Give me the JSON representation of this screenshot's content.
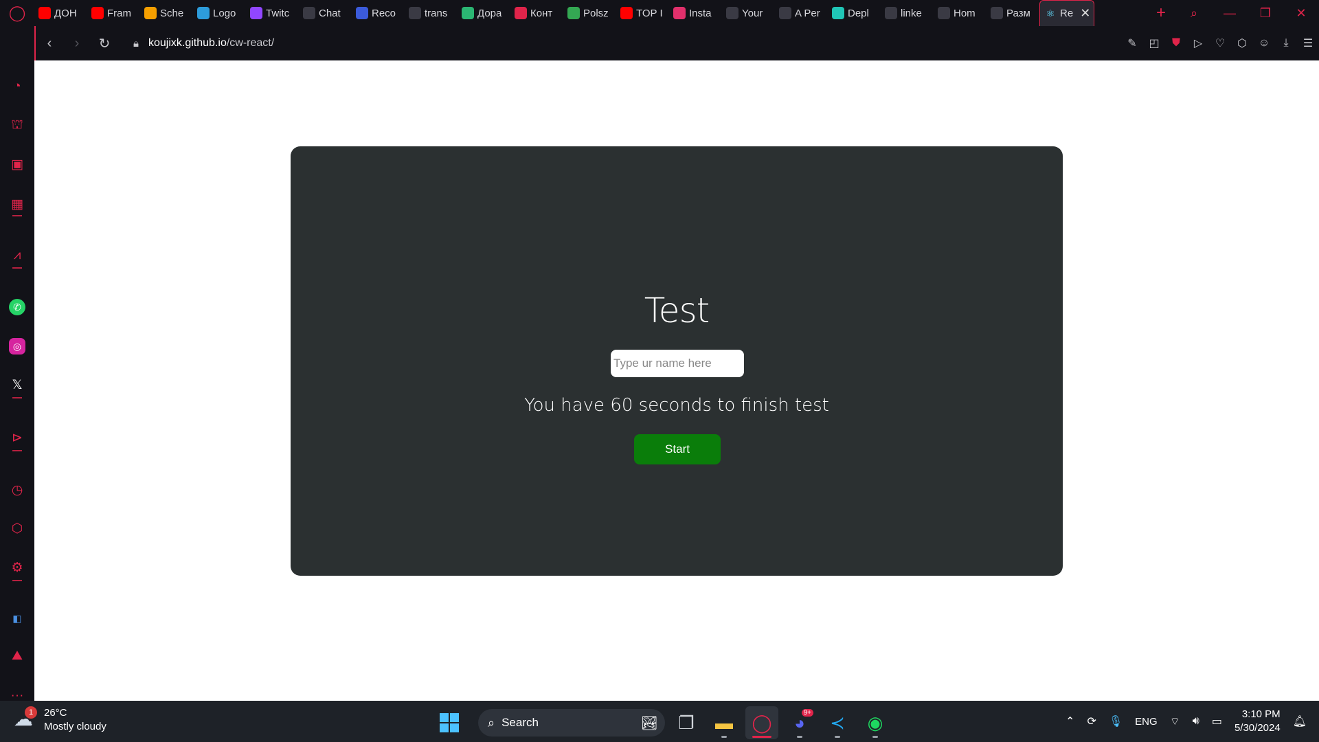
{
  "browser": {
    "tabs": [
      {
        "label": "ДОН",
        "icon": "youtube-icon",
        "color": "#ff0000"
      },
      {
        "label": "Fram",
        "icon": "youtube-icon",
        "color": "#ff0000"
      },
      {
        "label": "Sche",
        "icon": "u-icon",
        "color": "#f59f00"
      },
      {
        "label": "Logo",
        "icon": "logo-icon",
        "color": "#2d9cdb"
      },
      {
        "label": "Twitc",
        "icon": "twitch-icon",
        "color": "#9146ff"
      },
      {
        "label": "Chat",
        "icon": "openai-icon",
        "color": "#ffffff"
      },
      {
        "label": "Reco",
        "icon": "reco-icon",
        "color": "#3b5bdb"
      },
      {
        "label": "trans",
        "icon": "google-icon",
        "color": "#ffffff"
      },
      {
        "label": "Дора",
        "icon": "map-icon",
        "color": "#2bb673"
      },
      {
        "label": "Конт",
        "icon": "pin-icon",
        "color": "#e0244a"
      },
      {
        "label": "Polsz",
        "icon": "maps-icon",
        "color": "#34a853"
      },
      {
        "label": "TOP I",
        "icon": "youtube-icon",
        "color": "#ff0000"
      },
      {
        "label": "Insta",
        "icon": "instagram-icon",
        "color": "#e1306c"
      },
      {
        "label": "Your",
        "icon": "github-icon",
        "color": "#ffffff"
      },
      {
        "label": "A Per",
        "icon": "codepen-icon",
        "color": "#ffffff"
      },
      {
        "label": "Depl",
        "icon": "netlify-icon",
        "color": "#20c6b7"
      },
      {
        "label": "linke",
        "icon": "google-icon",
        "color": "#ffffff"
      },
      {
        "label": "Hom",
        "icon": "globe-icon",
        "color": "#ffffff"
      },
      {
        "label": "Разм",
        "icon": "x-icon",
        "color": "#ffffff"
      }
    ],
    "active_tab": {
      "label": "Re",
      "icon": "react-icon"
    },
    "url_host": "koujixk.github.io",
    "url_path": "/cw-react/"
  },
  "app": {
    "title": "Test",
    "name_placeholder": "Type ur name here",
    "info": "You have 60 seconds to finish test",
    "start_label": "Start"
  },
  "taskbar": {
    "weather_temp": "26°C",
    "weather_desc": "Mostly cloudy",
    "weather_badge": "1",
    "search_label": "Search",
    "discord_badge": "9+",
    "lang": "ENG",
    "time": "3:10 PM",
    "date": "5/30/2024"
  }
}
